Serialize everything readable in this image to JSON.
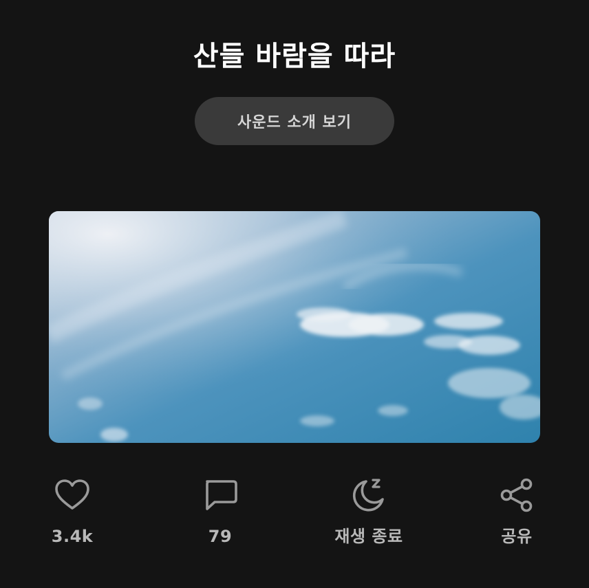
{
  "title": "산들 바람을 따라",
  "intro_button": "사운드 소개 보기",
  "cover": {
    "subject": "blue-sky-clouds-image"
  },
  "actions": [
    {
      "label": "3.4k",
      "icon": "heart-icon"
    },
    {
      "label": "79",
      "icon": "comment-icon"
    },
    {
      "label": "재생 종료",
      "icon": "moon-sleep-icon"
    },
    {
      "label": "공유",
      "icon": "share-icon"
    }
  ],
  "colors": {
    "background": "#141414",
    "button": "#3a3a3a",
    "icon": "#9a9a9a",
    "label": "#b9b9b9"
  }
}
